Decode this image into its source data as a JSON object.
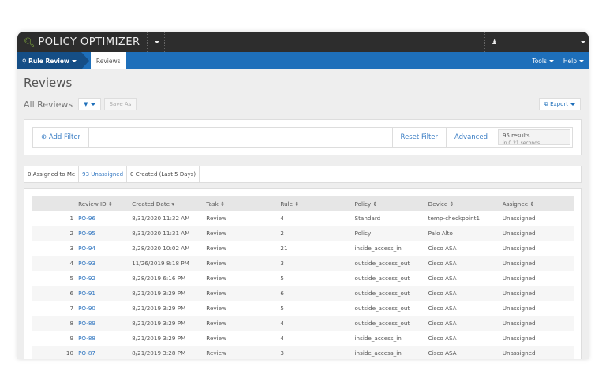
{
  "app": {
    "title": "POLICY OPTIMIZER",
    "key_icon": "key-icon",
    "user_icon": "user-icon"
  },
  "nav": {
    "module": "Rule Review",
    "breadcrumb": "Reviews",
    "tools": "Tools",
    "help": "Help"
  },
  "page": {
    "title": "Reviews",
    "view": "All Reviews",
    "save_as": "Save As",
    "export": "Export"
  },
  "filter": {
    "add": "Add Filter",
    "reset": "Reset Filter",
    "advanced": "Advanced",
    "results": "95 results",
    "time": "in 0.21 seconds"
  },
  "tabs": [
    "0 Assigned to Me",
    "93 Unassigned",
    "0 Created (Last 5 Days)"
  ],
  "table": {
    "headers": [
      "Review ID",
      "Created Date",
      "Task",
      "Rule",
      "Policy",
      "Device",
      "Assignee"
    ],
    "rows": [
      [
        "1",
        "PO-96",
        "8/31/2020 11:32 AM",
        "Review",
        "4",
        "Standard",
        "temp-checkpoint1",
        "Unassigned"
      ],
      [
        "2",
        "PO-95",
        "8/31/2020 11:31 AM",
        "Review",
        "2",
        "Policy",
        "Palo Alto",
        "Unassigned"
      ],
      [
        "3",
        "PO-94",
        "2/28/2020 10:02 AM",
        "Review",
        "21",
        "inside_access_in",
        "Cisco ASA",
        "Unassigned"
      ],
      [
        "4",
        "PO-93",
        "11/26/2019 8:18 PM",
        "Review",
        "3",
        "outside_access_out",
        "Cisco ASA",
        "Unassigned"
      ],
      [
        "5",
        "PO-92",
        "8/28/2019 6:16 PM",
        "Review",
        "5",
        "outside_access_out",
        "Cisco ASA",
        "Unassigned"
      ],
      [
        "6",
        "PO-91",
        "8/21/2019 3:29 PM",
        "Review",
        "6",
        "outside_access_out",
        "Cisco ASA",
        "Unassigned"
      ],
      [
        "7",
        "PO-90",
        "8/21/2019 3:29 PM",
        "Review",
        "5",
        "outside_access_out",
        "Cisco ASA",
        "Unassigned"
      ],
      [
        "8",
        "PO-89",
        "8/21/2019 3:29 PM",
        "Review",
        "4",
        "outside_access_out",
        "Cisco ASA",
        "Unassigned"
      ],
      [
        "9",
        "PO-88",
        "8/21/2019 3:29 PM",
        "Review",
        "4",
        "inside_access_in",
        "Cisco ASA",
        "Unassigned"
      ],
      [
        "10",
        "PO-87",
        "8/21/2019 3:28 PM",
        "Review",
        "3",
        "inside_access_in",
        "Cisco ASA",
        "Unassigned"
      ]
    ]
  },
  "colors": {
    "topbar": "#2d2d2d",
    "nav": "#1e6fba",
    "link": "#2f75c0"
  }
}
